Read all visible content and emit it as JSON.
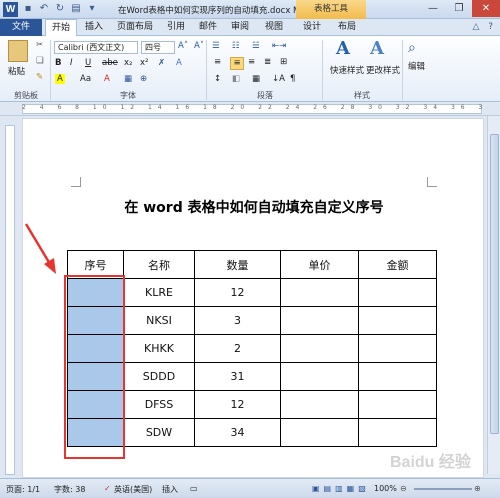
{
  "window": {
    "title": "在Word表格中如何实现序列的自动填充.docx M...",
    "contextual_tab": "表格工具",
    "controls": [
      "—",
      "❐",
      "✕"
    ]
  },
  "tabs": [
    "文件",
    "开始",
    "插入",
    "页面布局",
    "引用",
    "邮件",
    "审阅",
    "视图",
    "设计",
    "布局"
  ],
  "ribbon": {
    "clipboard": {
      "paste": "粘贴",
      "label": "剪贴板"
    },
    "font": {
      "name": "Calibri (西文正文)",
      "size": "四号",
      "label": "字体",
      "buttons": [
        "B",
        "I",
        "U",
        "abe",
        "x₂",
        "x²",
        "A",
        "A",
        "Aa",
        "A"
      ]
    },
    "paragraph": {
      "label": "段落"
    },
    "styles": {
      "quick": "快速样式",
      "change": "更改样式",
      "label": "样式"
    },
    "editing": {
      "label": "编辑"
    }
  },
  "ruler": {
    "numbers": "2 4 6 8 10 12 14 16 18 20 22 24 26 28 30 32 34 36 38 40 42"
  },
  "document": {
    "title": "在 word 表格中如何自动填充自定义序号",
    "table": {
      "headers": [
        "序号",
        "名称",
        "数量",
        "单价",
        "金额"
      ],
      "rows": [
        [
          "",
          "KLRE",
          "12",
          "",
          ""
        ],
        [
          "",
          "NKSI",
          "3",
          "",
          ""
        ],
        [
          "",
          "KHKK",
          "2",
          "",
          ""
        ],
        [
          "",
          "SDDD",
          "31",
          "",
          ""
        ],
        [
          "",
          "DFSS",
          "12",
          "",
          ""
        ],
        [
          "",
          "SDW",
          "34",
          "",
          ""
        ]
      ]
    }
  },
  "status": {
    "page": "页面: 1/1",
    "words": "字数: 38",
    "language": "英语(美国)",
    "mode": "插入",
    "zoom": "100%"
  },
  "watermark": "Baidu 经验",
  "colors": {
    "file_tab": "#2a5699",
    "selection": "#aac8ea",
    "annotation": "#e8342e",
    "contextual": "#f2bb4c"
  }
}
